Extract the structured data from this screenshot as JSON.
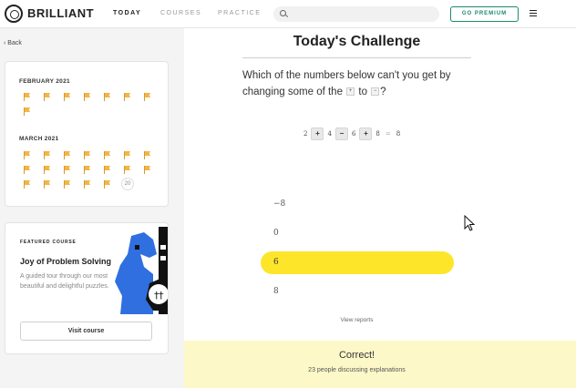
{
  "header": {
    "brand": "BRILLIANT",
    "nav": [
      "TODAY",
      "COURSES",
      "PRACTICE"
    ],
    "active_nav": "TODAY",
    "search_placeholder": "",
    "premium_label": "GO PREMIUM",
    "accent_color": "#1a8a6e"
  },
  "sidebar": {
    "back_label": "Back",
    "calendar": {
      "months": [
        {
          "label": "FEBRUARY 2021",
          "flag_count": 8
        },
        {
          "label": "MARCH 2021",
          "flag_count": 19,
          "current_day": "20"
        }
      ]
    },
    "course": {
      "featured_label": "FEATURED COURSE",
      "title": "Joy of Problem Solving",
      "description": "A guided tour through our most beautiful and delightful puzzles.",
      "button_label": "Visit course"
    }
  },
  "challenge": {
    "title": "Today's Challenge",
    "question_before": "Which of the numbers below can't you get by changing some of the",
    "question_from": "+",
    "question_mid": "to",
    "question_to": "−",
    "question_end": "?",
    "expression": {
      "n1": "2",
      "op1": "+",
      "n2": "4",
      "op2": "−",
      "n3": "6",
      "op3": "+",
      "n4": "8",
      "eq": "=",
      "result": "8"
    },
    "options": [
      "−8",
      "0",
      "6",
      "8"
    ],
    "selected_index": 2,
    "selected_color": "#fde52a",
    "view_reports": "View reports",
    "result_title": "Correct!",
    "result_subtitle": "23 people discussing explanations"
  }
}
